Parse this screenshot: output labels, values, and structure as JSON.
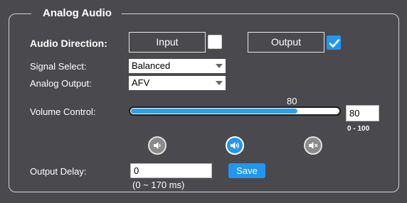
{
  "panel": {
    "title": "Analog Audio"
  },
  "audio_direction": {
    "label": "Audio Direction:",
    "input_label": "Input",
    "input_checked": false,
    "output_label": "Output",
    "output_checked": true
  },
  "signal_select": {
    "label": "Signal Select:",
    "value": "Balanced"
  },
  "analog_output": {
    "label": "Analog Output:",
    "value": "AFV"
  },
  "volume": {
    "label": "Volume Control:",
    "value": 80,
    "slider_label": "80",
    "input_value": "80",
    "range": "0 - 100",
    "min": 0,
    "max": 100,
    "icons": {
      "decrease": "volume-down-icon",
      "increase": "volume-up-icon",
      "mute": "volume-mute-icon"
    }
  },
  "output_delay": {
    "label": "Output Delay:",
    "value": "0",
    "range": "(0 ~ 170 ms)",
    "save_label": "Save"
  },
  "colors": {
    "background": "#4a4a4e",
    "accent": "#2196f3",
    "slider_fill": "#2aa3e8"
  }
}
